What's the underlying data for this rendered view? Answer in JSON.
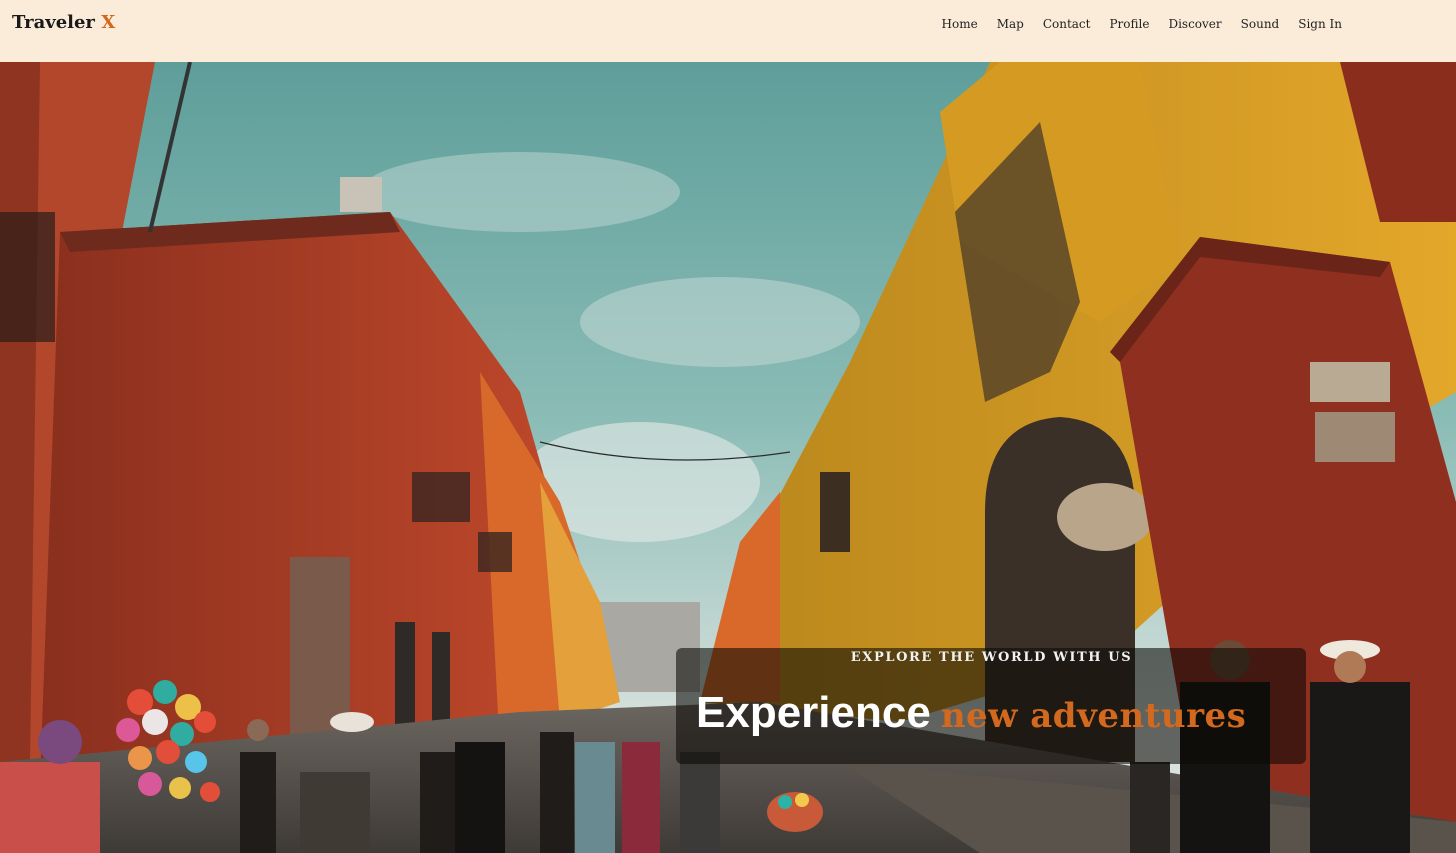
{
  "brand": {
    "name": "Traveler",
    "accent_letter": "X",
    "accent_color": "#d2691e"
  },
  "nav": {
    "items": [
      {
        "label": "Home"
      },
      {
        "label": "Map"
      },
      {
        "label": "Contact"
      },
      {
        "label": "Profile"
      },
      {
        "label": "Discover"
      },
      {
        "label": "Sound"
      },
      {
        "label": "Sign In"
      }
    ]
  },
  "hero": {
    "tagline": "EXPLORE THE WORLD WITH US",
    "headline_main": "Experience",
    "headline_accent": "new adventures"
  },
  "colors": {
    "navbar_bg": "#faecd9",
    "accent": "#d2691e",
    "overlay": "rgba(10,8,6,0.58)"
  }
}
